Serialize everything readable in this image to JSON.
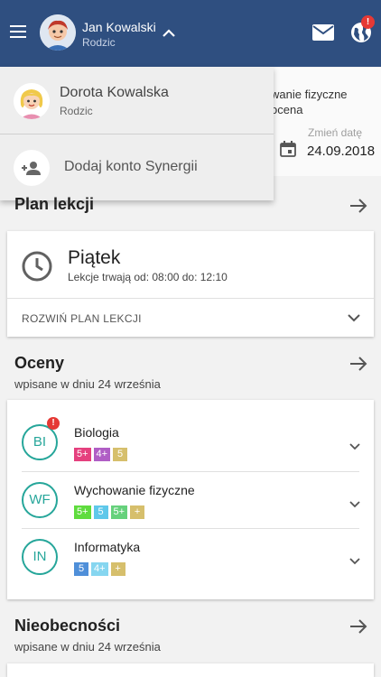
{
  "header": {
    "user_name": "Jan Kowalski",
    "user_role": "Rodzic",
    "notification_count": "!"
  },
  "dropdown": {
    "account_name": "Dorota Kowalska",
    "account_role": "Rodzic",
    "add_account_label": "Dodaj konto Synergii"
  },
  "background": {
    "subject_peek": "wanie fizyczne",
    "grade_peek": "ocena",
    "change_date_label": "Zmień datę",
    "date_value": "24.09.2018"
  },
  "plan": {
    "title": "Plan lekcji",
    "day": "Piątek",
    "hours": "Lekcje trwają od: 08:00 do: 12:10",
    "expand_label": "ROZWIŃ PLAN LEKCJI"
  },
  "grades": {
    "title": "Oceny",
    "subtitle": "wpisane w dniu  24 września",
    "subjects": [
      {
        "abbr": "BI",
        "name": "Biologia",
        "badge": "!",
        "chips": [
          {
            "label": "5+",
            "color": "#e5407e"
          },
          {
            "label": "4+",
            "color": "#b05ec5"
          },
          {
            "label": "5",
            "color": "#d6bf6c"
          }
        ]
      },
      {
        "abbr": "WF",
        "name": "Wychowanie fizyczne",
        "chips": [
          {
            "label": "5+",
            "color": "#5fdc3e"
          },
          {
            "label": "5",
            "color": "#5fc8ea"
          },
          {
            "label": "5+",
            "color": "#66d17c"
          },
          {
            "label": "+",
            "color": "#d6bf6c"
          }
        ]
      },
      {
        "abbr": "IN",
        "name": "Informatyka",
        "chips": [
          {
            "label": "5",
            "color": "#4f8fd9"
          },
          {
            "label": "4+",
            "color": "#86d6f0"
          },
          {
            "label": "+",
            "color": "#d6bf6c"
          }
        ]
      }
    ]
  },
  "absences": {
    "title": "Nieobecności",
    "subtitle": "wpisane w dniu  24 września"
  },
  "colors": {
    "topbar": "#2f4f80",
    "accent_teal": "#26a69a",
    "badge_red": "#e53935"
  },
  "icons": [
    "menu-icon",
    "chevron-up-icon",
    "mail-icon",
    "globe-icon",
    "calendar-icon",
    "add-person-icon",
    "arrow-right-icon",
    "clock-icon",
    "chevron-down-icon"
  ]
}
